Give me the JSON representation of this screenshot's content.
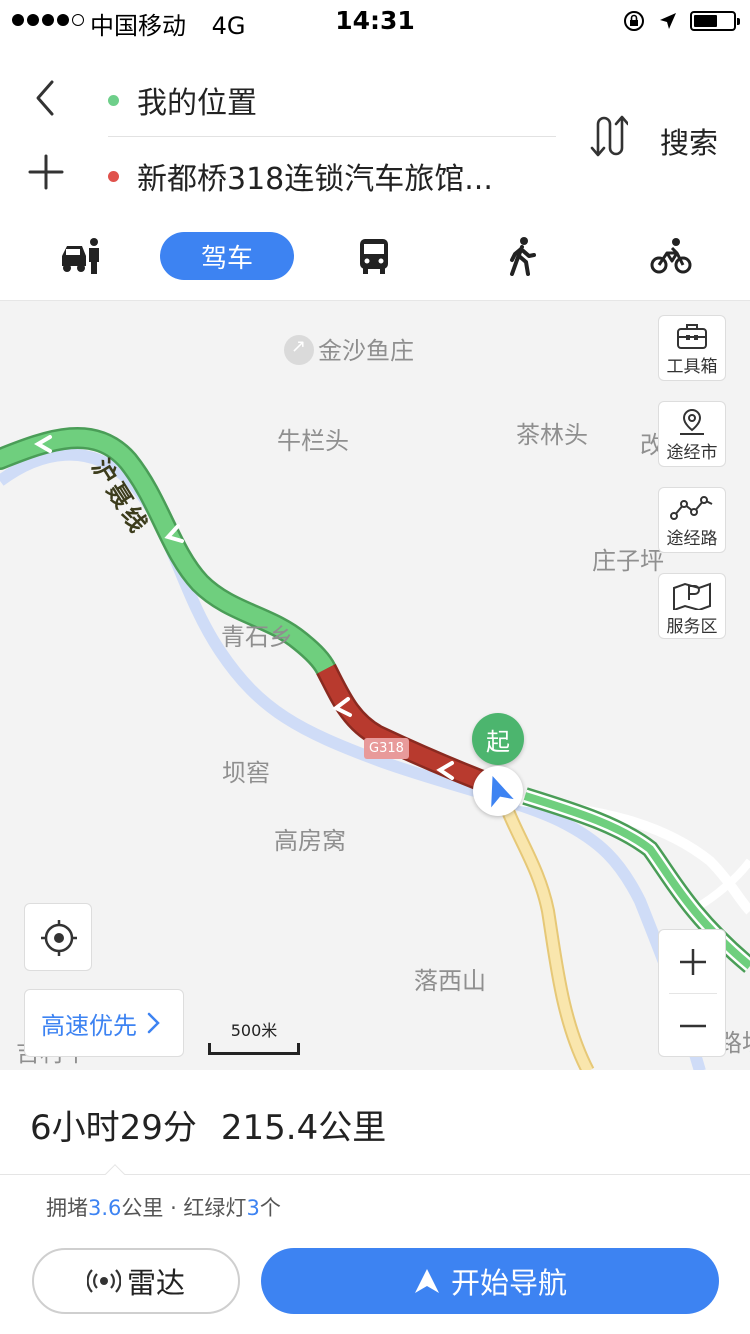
{
  "status_bar": {
    "carrier": "中国移动",
    "network": "4G",
    "time": "14:31",
    "battery_level": 0.6
  },
  "route": {
    "back_icon": "chevron-left-icon",
    "add_icon": "plus-icon",
    "from_label": "我的位置",
    "to_label": "新都桥318连锁汽车旅馆...",
    "from_dot_color": "#6ecf8a",
    "to_dot_color": "#e0524c",
    "swap_icon": "swap-icon",
    "search_label": "搜索"
  },
  "modes": [
    {
      "name": "taxi",
      "icon": "taxi-icon"
    },
    {
      "name": "drive",
      "label": "驾车",
      "active": true
    },
    {
      "name": "bus",
      "icon": "bus-icon"
    },
    {
      "name": "walk",
      "icon": "walk-icon"
    },
    {
      "name": "bike",
      "icon": "bike-icon"
    }
  ],
  "map": {
    "places": {
      "jinsha": "金沙鱼庄",
      "niulantou": "牛栏头",
      "chalintou": "茶林头",
      "gai": "改",
      "zhuangziping": "庄子坪",
      "qingshixiang": "青石乡",
      "bayao": "坝窖",
      "gaofangwo": "高房窝",
      "luoxishan": "落西山",
      "cut_left": "吉村平",
      "cut_right": "路坎"
    },
    "highway_name": "沪聂线",
    "road_shield": "G318",
    "start_marker": "起",
    "tools": [
      {
        "label": "工具箱",
        "icon": "toolbox-icon"
      },
      {
        "label": "途经市",
        "icon": "location-pin-icon"
      },
      {
        "label": "途经路",
        "icon": "route-path-icon"
      },
      {
        "label": "服务区",
        "icon": "service-area-icon"
      }
    ],
    "highway_pref": "高速优先",
    "scale_label": "500米",
    "colors": {
      "traffic_smooth": "#6fcf7e",
      "traffic_congested": "#b83a2e",
      "river": "#cfdcf7",
      "road_yellow": "#f7e2a5",
      "accent": "#3d83f2"
    }
  },
  "summary": {
    "duration": "6小时29分",
    "distance": "215.4公里"
  },
  "traffic": {
    "congestion_prefix": "拥堵",
    "congestion_value": "3.6",
    "congestion_unit": "公里 · 红绿灯",
    "lights_value": "3",
    "lights_unit": "个"
  },
  "actions": {
    "radar_label": "雷达",
    "start_nav_label": "开始导航"
  }
}
